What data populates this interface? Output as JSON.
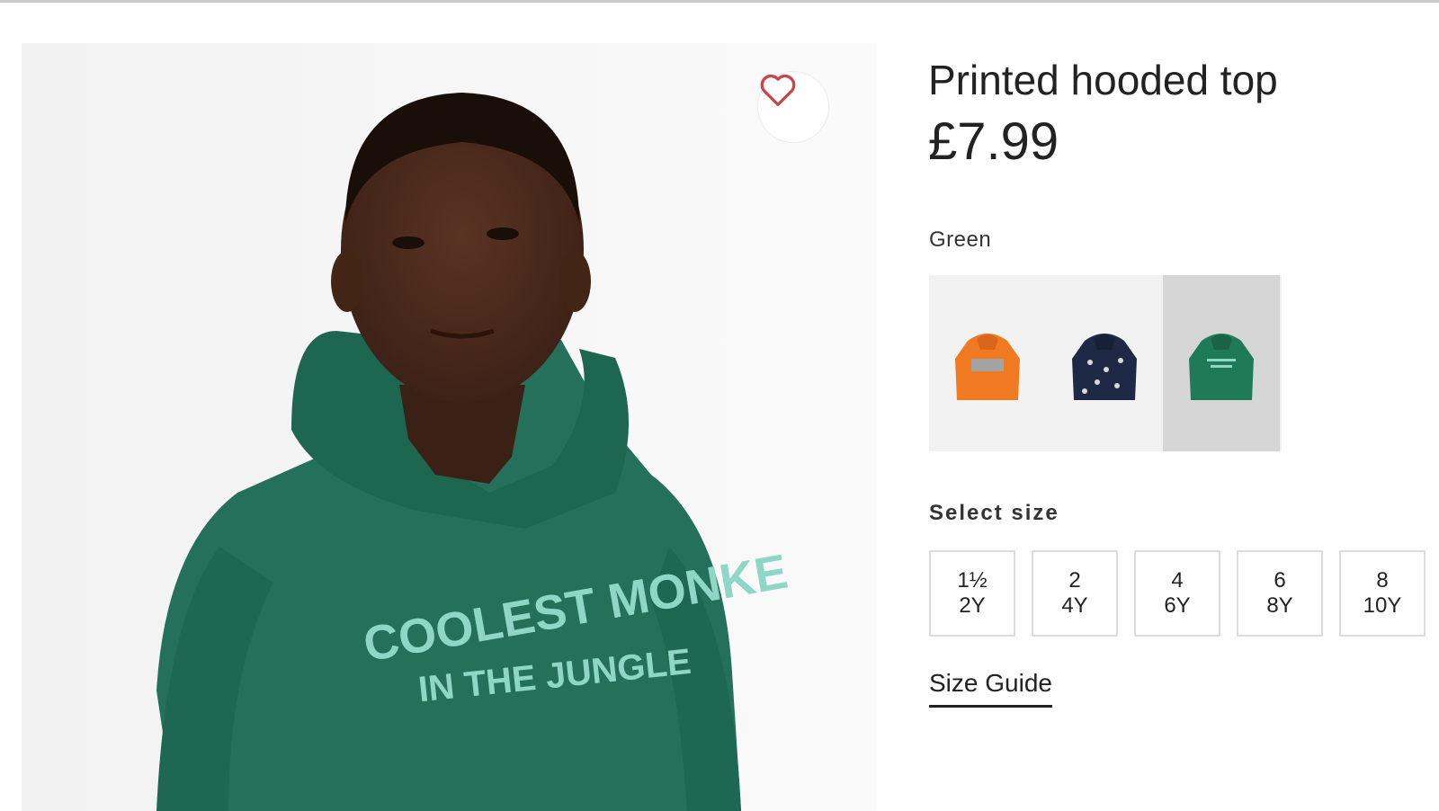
{
  "product": {
    "title": "Printed hooded top",
    "price": "£7.99",
    "image_print_text": {
      "line1": "COOLEST MONKE",
      "line2": "IN THE JUNGLE"
    },
    "favorite_icon": "heart-outline-icon"
  },
  "color": {
    "selected_label": "Green",
    "swatches": [
      {
        "name": "orange-hoodie",
        "color": "#f07a22",
        "selected": false
      },
      {
        "name": "navy-hoodie",
        "color": "#1e2a45",
        "selected": false
      },
      {
        "name": "green-hoodie",
        "color": "#1f7a5a",
        "selected": true
      }
    ]
  },
  "size": {
    "label": "Select size",
    "options": [
      {
        "top": "1½",
        "bottom": "2Y"
      },
      {
        "top": "2",
        "bottom": "4Y"
      },
      {
        "top": "4",
        "bottom": "6Y"
      },
      {
        "top": "6",
        "bottom": "8Y"
      },
      {
        "top": "8",
        "bottom": "10Y"
      }
    ],
    "guide_label": "Size Guide"
  },
  "colors": {
    "hoodie_green": "#24705a",
    "print_text": "#8fd6c6",
    "skin": "#4a2a1c",
    "heart": "#c8454a"
  }
}
